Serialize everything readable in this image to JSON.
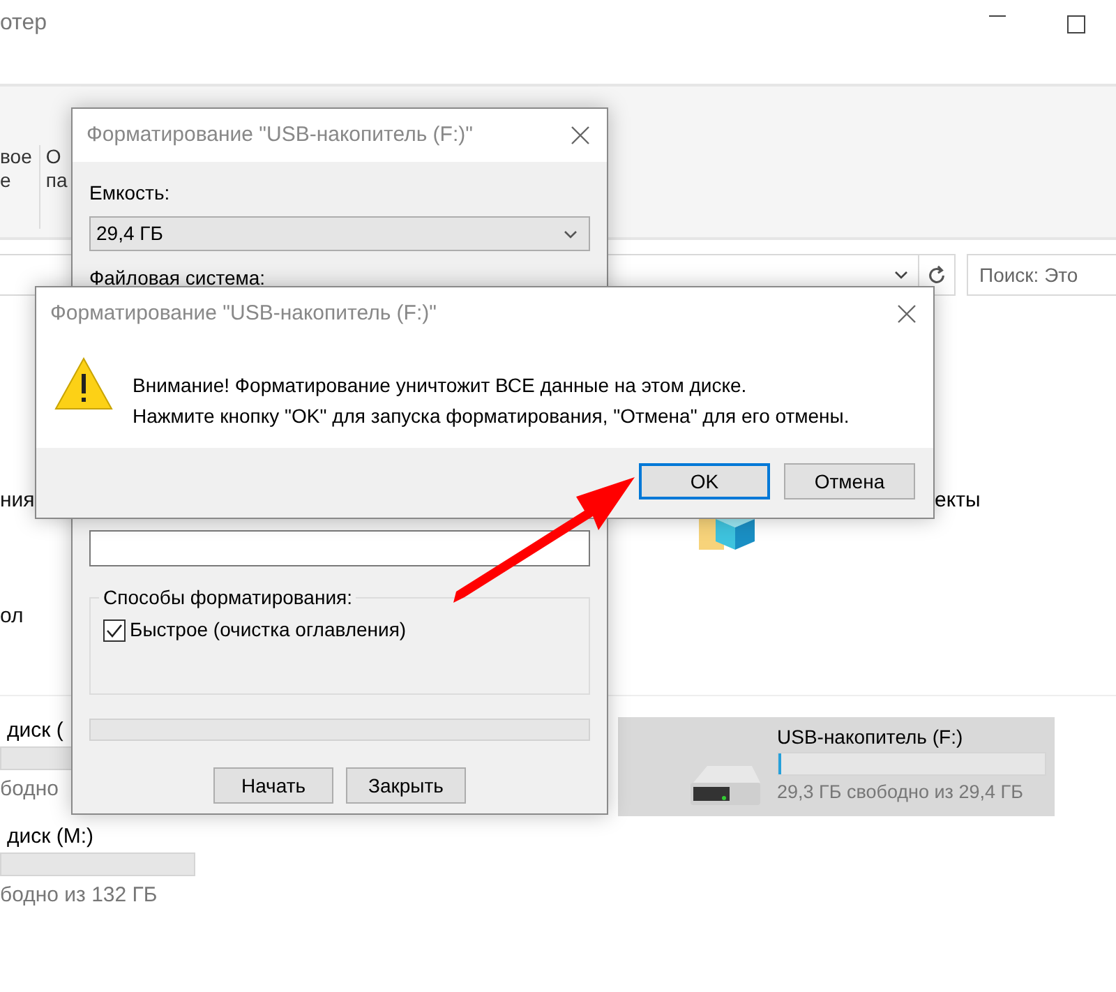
{
  "explorer": {
    "title_fragment": "отер",
    "ribbon_fragments": [
      {
        "lines": [
          "вое",
          "е"
        ]
      },
      {
        "lines": [
          "О",
          "па"
        ]
      }
    ],
    "search": {
      "placeholder": "Поиск: Это"
    },
    "nav_fragments": [
      "ния",
      "ол"
    ],
    "folder_label_fragment": "екты",
    "drives": [
      {
        "name": "диск (",
        "free": "бодно"
      },
      {
        "name": "диск (M:)",
        "free": "бодно из 132 ГБ"
      }
    ],
    "usb_drive": {
      "name": "USB-накопитель (F:)",
      "free": "29,3 ГБ свободно из 29,4 ГБ",
      "level": 0.01,
      "selected": true
    }
  },
  "format_dialog": {
    "title": "Форматирование \"USB-накопитель (F:)\"",
    "capacity_label": "Емкость:",
    "capacity_value": "29,4 ГБ",
    "filesystem_label": "Файловая система:",
    "options_legend": "Способы форматирования:",
    "quick_format": {
      "label": "Быстрое (очистка оглавления)",
      "checked": true
    },
    "progress": {
      "level": 0
    },
    "buttons": [
      "Начать",
      "Закрыть"
    ]
  },
  "warning_dialog": {
    "title": "Форматирование \"USB-накопитель (F:)\"",
    "message": [
      "Внимание! Форматирование уничтожит ВСЕ данные на этом диске.",
      "Нажмите кнопку \"OK\" для запуска форматирования, \"Отмена\" для его отмены."
    ],
    "buttons": [
      {
        "label": "OK",
        "focused": true
      },
      {
        "label": "Отмена",
        "focused": false
      }
    ]
  }
}
